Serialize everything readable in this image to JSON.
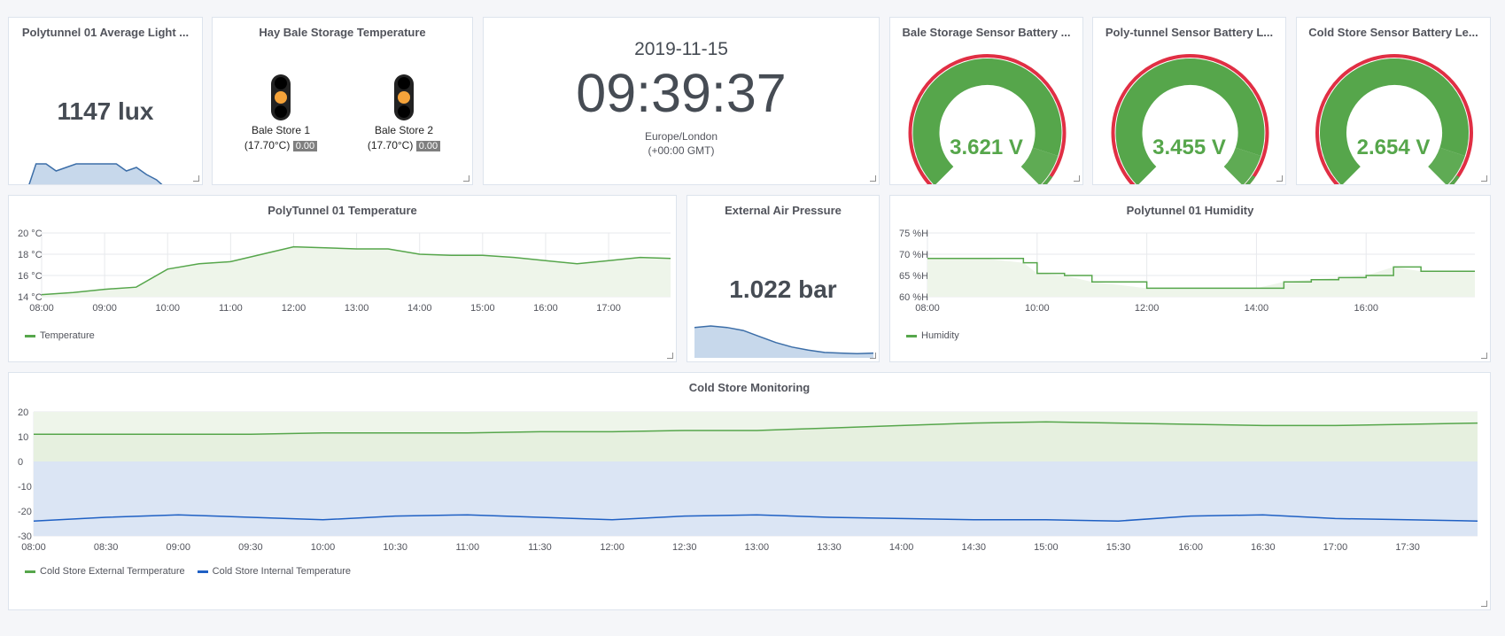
{
  "colors": {
    "green": "#56a64b",
    "green_fill": "#eef5ea",
    "blue": "#1f60c4",
    "blue_fill": "#dbe5f4",
    "blue_area": "#c7d8eb",
    "red": "#e02f44",
    "amber": "#f5a33a"
  },
  "panels": {
    "light": {
      "title": "Polytunnel 01 Average Light ...",
      "value": "1147 lux"
    },
    "hay": {
      "title": "Hay Bale Storage Temperature",
      "lights": [
        {
          "name": "Bale Store 1",
          "temp": "(17.70°C)",
          "badge": "0.00"
        },
        {
          "name": "Bale Store 2",
          "temp": "(17.70°C)",
          "badge": "0.00"
        }
      ]
    },
    "clock": {
      "date": "2019-11-15",
      "time": "09:39:37",
      "zone": "Europe/London",
      "offset": "(+00:00 GMT)"
    },
    "bale_batt": {
      "title": "Bale Storage Sensor Battery ...",
      "value": "3.621 V",
      "fraction": 0.9
    },
    "poly_batt": {
      "title": "Poly-tunnel Sensor Battery L...",
      "value": "3.455 V",
      "fraction": 0.9
    },
    "cold_batt": {
      "title": "Cold Store Sensor Battery Le...",
      "value": "2.654 V",
      "fraction": 0.9
    },
    "pressure": {
      "title": "External Air Pressure",
      "value": "1.022 bar"
    },
    "poly_temp": {
      "title": "PolyTunnel 01 Temperature"
    },
    "humidity": {
      "title": "Polytunnel 01 Humidity"
    },
    "cold": {
      "title": "Cold Store Monitoring"
    }
  },
  "chart_data": [
    {
      "id": "poly_temp",
      "type": "line",
      "title": "PolyTunnel 01 Temperature",
      "x": [
        "08:00",
        "08:30",
        "09:00",
        "09:30",
        "10:00",
        "10:30",
        "11:00",
        "11:30",
        "12:00",
        "12:30",
        "13:00",
        "13:30",
        "14:00",
        "14:30",
        "15:00",
        "15:30",
        "16:00",
        "16:30",
        "17:00",
        "17:30",
        "17:59"
      ],
      "x_ticks": [
        "08:00",
        "09:00",
        "10:00",
        "11:00",
        "12:00",
        "13:00",
        "14:00",
        "15:00",
        "16:00",
        "17:00"
      ],
      "y_ticks": [
        "14 °C",
        "16 °C",
        "18 °C",
        "20 °C"
      ],
      "ylim": [
        14,
        20
      ],
      "grid": true,
      "legend_position": "bottom-left",
      "series": [
        {
          "name": "Temperature",
          "values": [
            14.2,
            14.4,
            14.7,
            14.9,
            16.6,
            17.1,
            17.3,
            18.0,
            18.7,
            18.6,
            18.5,
            18.5,
            18.0,
            17.9,
            17.9,
            17.7,
            17.4,
            17.1,
            17.4,
            17.7,
            17.6
          ]
        }
      ]
    },
    {
      "id": "humidity",
      "type": "line",
      "title": "Polytunnel 01 Humidity",
      "x": [
        "08:00",
        "09:00",
        "09:45",
        "10:00",
        "10:30",
        "11:00",
        "12:00",
        "13:00",
        "14:00",
        "14:30",
        "15:00",
        "15:30",
        "16:00",
        "16:30",
        "17:00",
        "17:59"
      ],
      "x_ticks": [
        "08:00",
        "10:00",
        "12:00",
        "14:00",
        "16:00"
      ],
      "y_ticks": [
        "60 %H",
        "65 %H",
        "70 %H",
        "75 %H"
      ],
      "ylim": [
        60,
        75
      ],
      "grid": true,
      "legend_position": "bottom-left",
      "series": [
        {
          "name": "Humidity",
          "values": [
            69,
            69,
            68,
            65.5,
            65,
            63.5,
            62,
            62,
            62,
            63.5,
            64,
            64.5,
            65,
            67,
            66,
            66
          ]
        }
      ]
    },
    {
      "id": "cold",
      "type": "line",
      "title": "Cold Store Monitoring",
      "x": [
        "08:00",
        "08:30",
        "09:00",
        "09:30",
        "10:00",
        "10:30",
        "11:00",
        "11:30",
        "12:00",
        "12:30",
        "13:00",
        "13:30",
        "14:00",
        "14:30",
        "15:00",
        "15:30",
        "16:00",
        "16:30",
        "17:00",
        "17:30",
        "17:59"
      ],
      "x_ticks": [
        "08:00",
        "08:30",
        "09:00",
        "09:30",
        "10:00",
        "10:30",
        "11:00",
        "11:30",
        "12:00",
        "12:30",
        "13:00",
        "13:30",
        "14:00",
        "14:30",
        "15:00",
        "15:30",
        "16:00",
        "16:30",
        "17:00",
        "17:30"
      ],
      "y_ticks": [
        "-30",
        "-20",
        "-10",
        "0",
        "10",
        "20"
      ],
      "ylim": [
        -30,
        20
      ],
      "grid": true,
      "legend_position": "bottom-left",
      "series": [
        {
          "name": "Cold Store External Termperature",
          "values": [
            11,
            11,
            11,
            11,
            11.5,
            11.5,
            11.5,
            12,
            12,
            12.5,
            12.5,
            13.5,
            14.5,
            15.5,
            16,
            15.5,
            15,
            14.5,
            14.5,
            15,
            15.5
          ]
        },
        {
          "name": "Cold Store Internal Temperature",
          "values": [
            -24,
            -22.5,
            -21.5,
            -22.5,
            -23.5,
            -22,
            -21.5,
            -22.5,
            -23.5,
            -22,
            -21.5,
            -22.5,
            -23,
            -23.5,
            -23.5,
            -24,
            -22,
            -21.5,
            -23,
            -23.5,
            -24
          ]
        }
      ]
    },
    {
      "id": "light_spark",
      "type": "area",
      "values": [
        0,
        0,
        0.85,
        0.85,
        0.65,
        0.75,
        0.85,
        0.85,
        0.85,
        0.85,
        0.85,
        0.65,
        0.75,
        0.55,
        0.4,
        0.15,
        0.05,
        0,
        0
      ]
    },
    {
      "id": "pressure_spark",
      "type": "area",
      "values": [
        0.95,
        1,
        0.95,
        0.85,
        0.65,
        0.45,
        0.3,
        0.2,
        0.12,
        0.1,
        0.08,
        0.1
      ]
    }
  ]
}
